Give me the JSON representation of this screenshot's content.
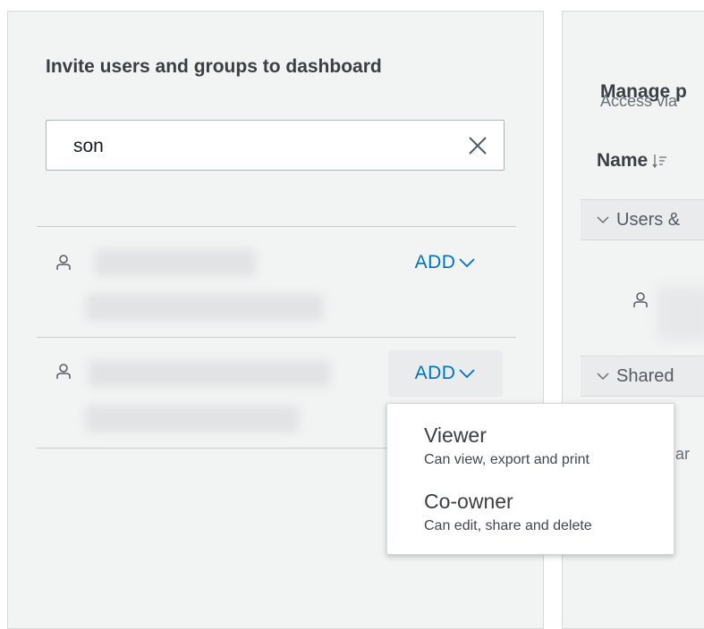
{
  "invite_panel": {
    "title": "Invite users and groups to dashboard",
    "search": {
      "value": "son"
    },
    "results": [
      {
        "add_label": "ADD",
        "active": false
      },
      {
        "add_label": "ADD",
        "active": true
      }
    ]
  },
  "role_menu": {
    "options": [
      {
        "title": "Viewer",
        "description": "Can view, export and print"
      },
      {
        "title": "Co-owner",
        "description": "Can edit, share and delete"
      }
    ]
  },
  "manage_panel": {
    "title": "Manage p",
    "subtitle": "Access via",
    "name_column": "Name",
    "section_users": "Users &",
    "section_shared": "Shared",
    "partial_text": "har"
  },
  "colors": {
    "link": "#0073bb",
    "panel_bg": "#f2f3f3",
    "text": "#3a3f44"
  }
}
